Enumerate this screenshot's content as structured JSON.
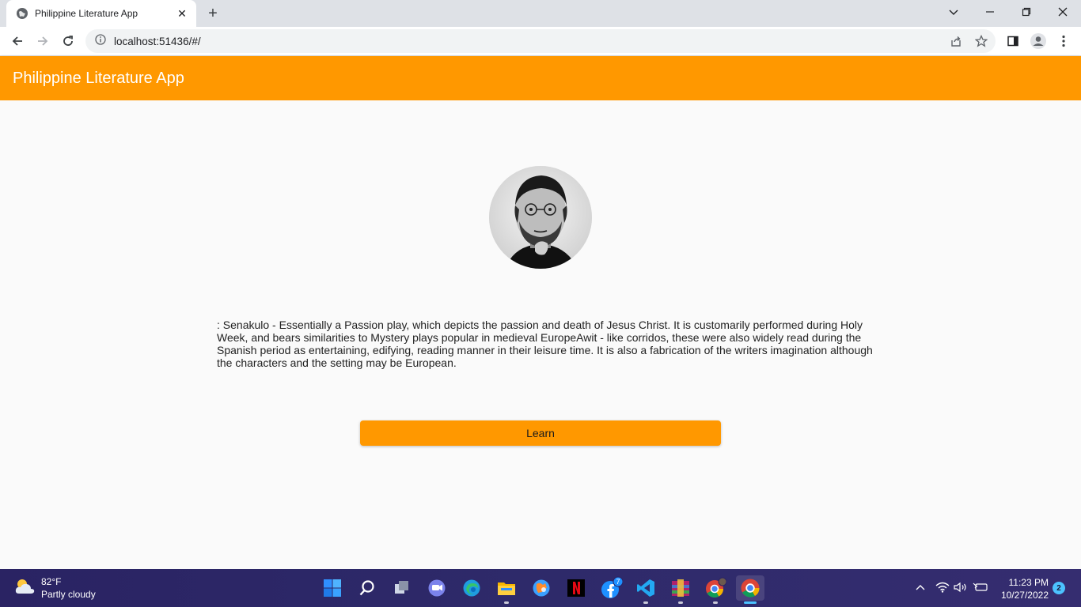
{
  "browser": {
    "tab_title": "Philippine Literature App",
    "url": "localhost:51436/#/"
  },
  "app": {
    "title": "Philippine Literature App",
    "description": " : Senakulo - Essentially a Passion play, which depicts the passion and death of Jesus Christ. It is customarily performed during Holy Week, and bears similarities to Mystery plays popular in medieval EuropeAwit - like corridos, these were also widely read during the Spanish period as entertaining, edifying, reading manner in their leisure time. It is also a fabrication of the writers imagination although the characters and the setting may be European.",
    "learn_label": "Learn",
    "accent_color": "#ff9800"
  },
  "taskbar": {
    "weather_temp": "82°F",
    "weather_desc": "Partly cloudy",
    "time": "11:23 PM",
    "date": "10/27/2022",
    "notification_count": "2",
    "messenger_badge": "7"
  }
}
